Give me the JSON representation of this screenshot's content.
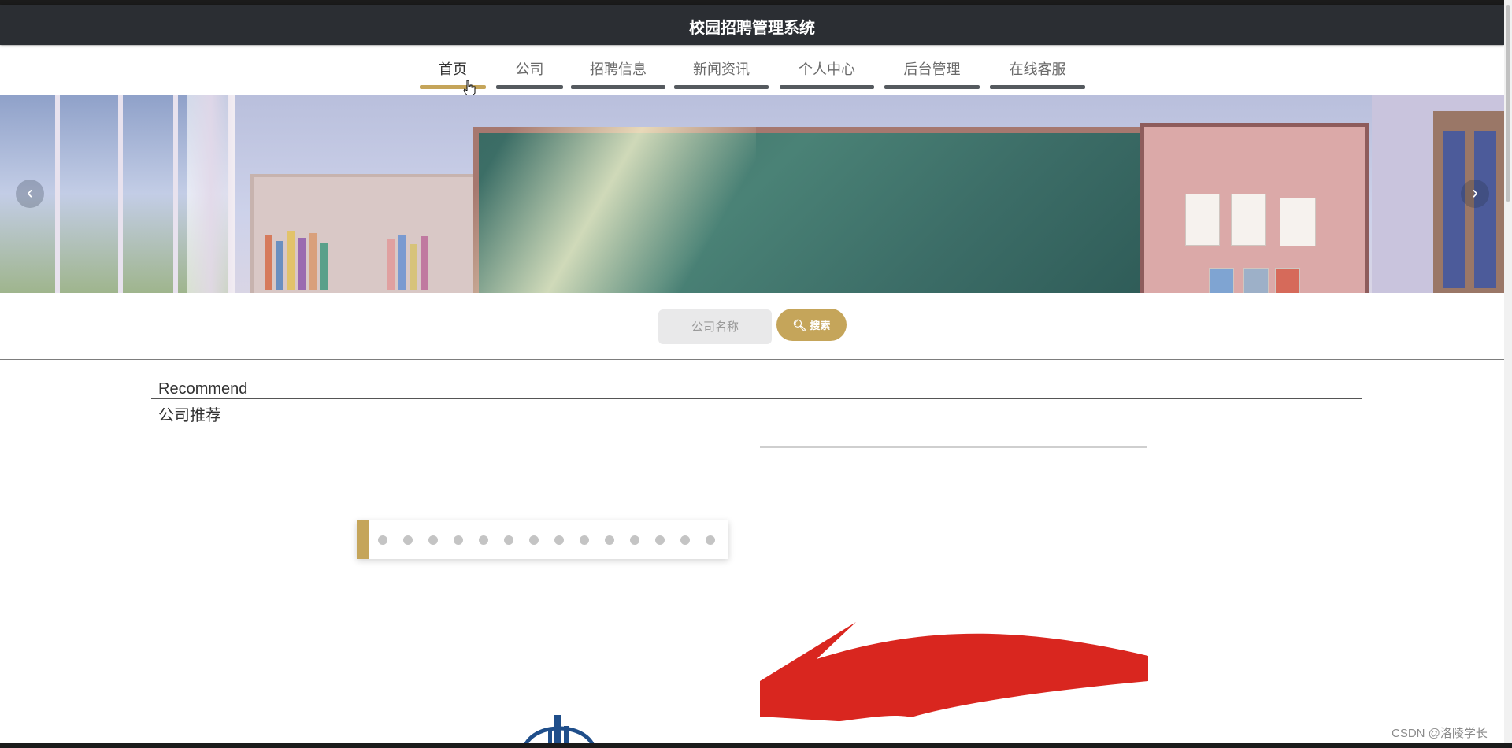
{
  "header": {
    "title": "校园招聘管理系统"
  },
  "nav": {
    "items": [
      {
        "label": "首页",
        "active": true
      },
      {
        "label": "公司",
        "active": false
      },
      {
        "label": "招聘信息",
        "active": false
      },
      {
        "label": "新闻资讯",
        "active": false
      },
      {
        "label": "个人中心",
        "active": false
      },
      {
        "label": "后台管理",
        "active": false
      },
      {
        "label": "在线客服",
        "active": false
      }
    ]
  },
  "banner": {
    "prev_icon": "chevron-left-icon",
    "next_icon": "chevron-right-icon"
  },
  "search": {
    "placeholder": "公司名称",
    "button_label": "搜索",
    "button_icon": "search-icon"
  },
  "recommend": {
    "title_en": "Recommend",
    "title_cn": "公司推荐"
  },
  "pager": {
    "dot_count": 14
  },
  "colors": {
    "accent": "#c5a55a",
    "header_bg": "#2b2e33",
    "nav_bar": "#555a5f"
  },
  "watermark": "CSDN @洛陵学长"
}
